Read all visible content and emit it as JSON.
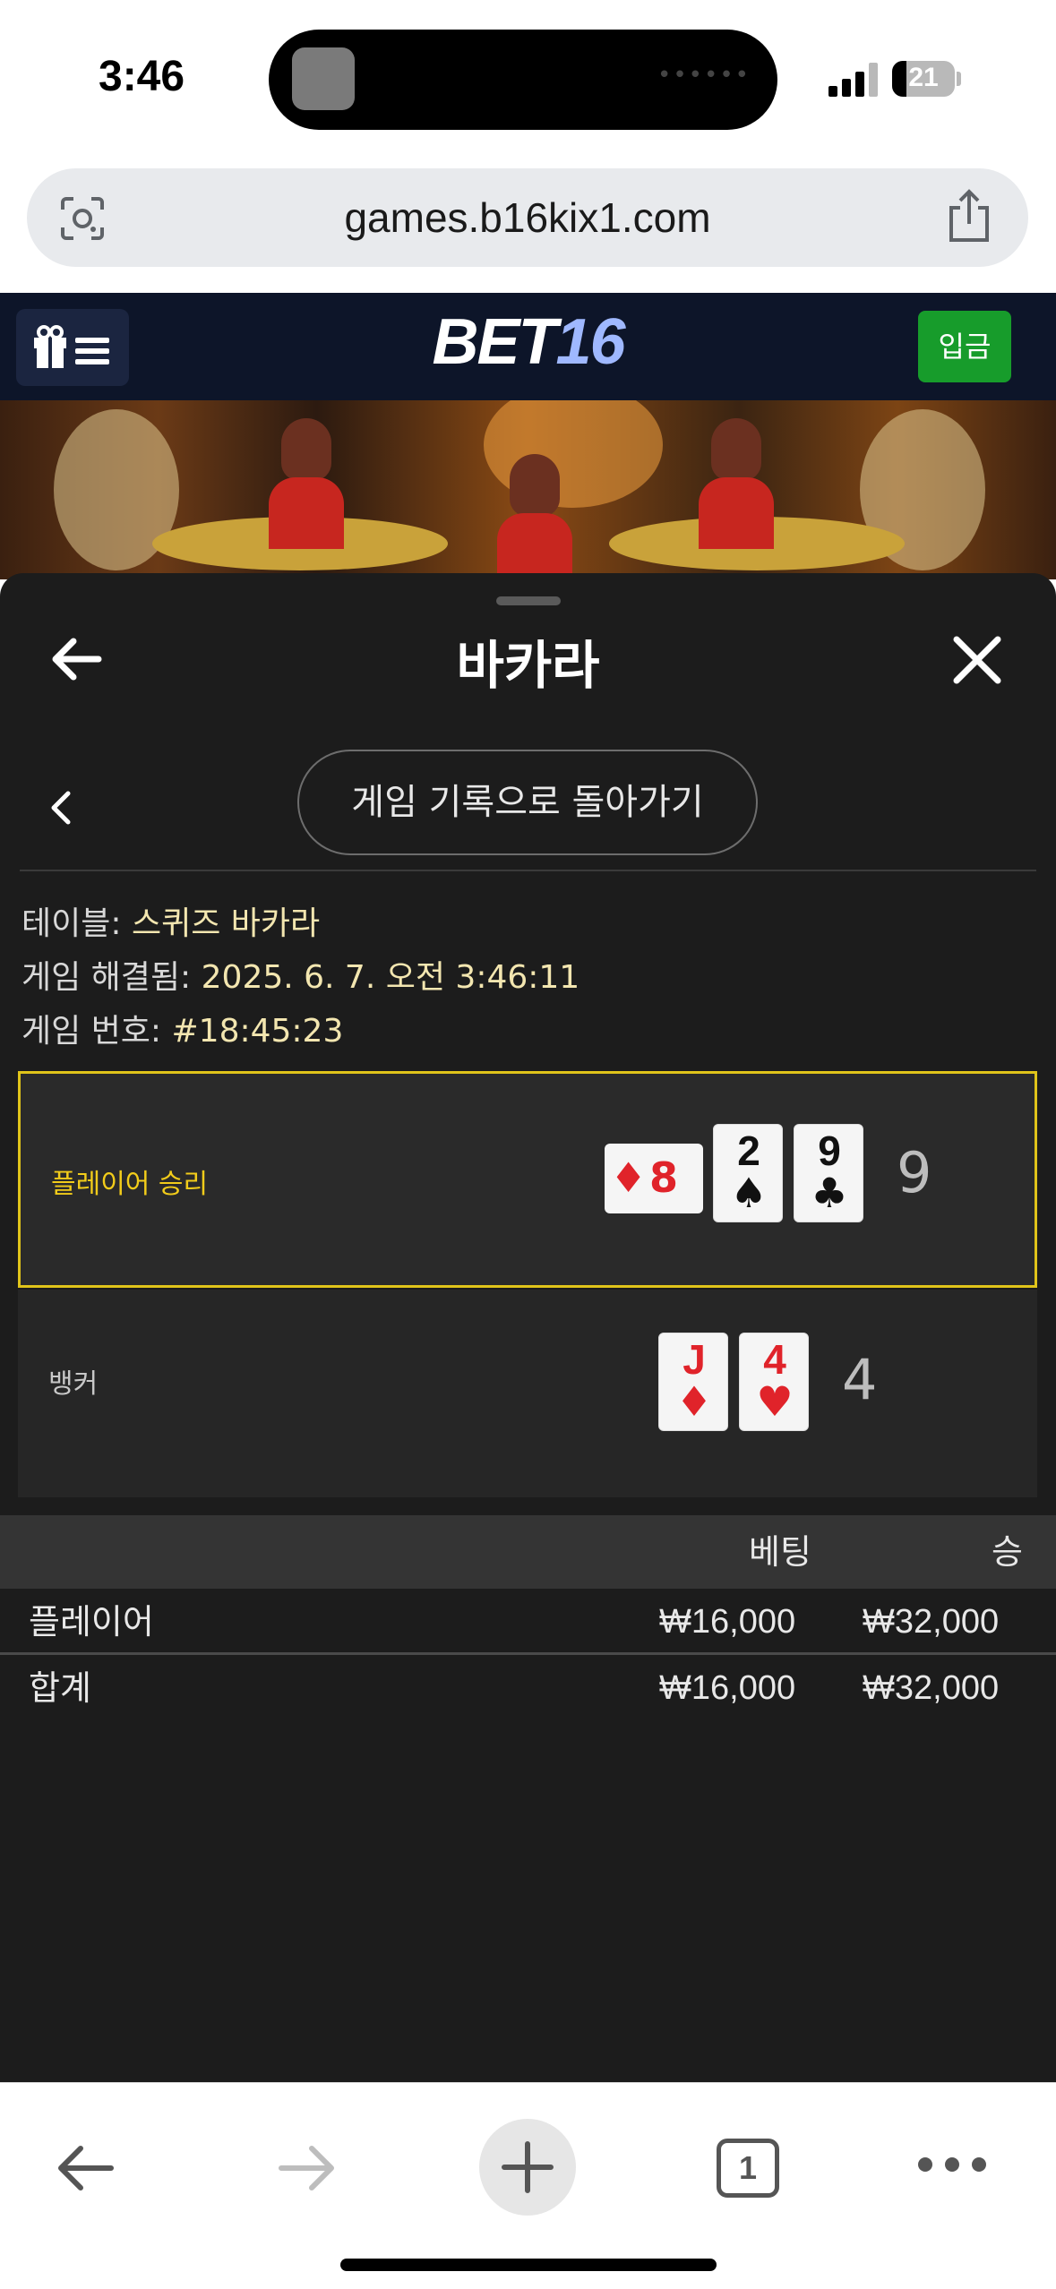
{
  "status_bar": {
    "time": "3:46",
    "battery": "21"
  },
  "browser": {
    "url": "games.b16kix1.com",
    "open_tabs": "1"
  },
  "site_header": {
    "logo_main": "BET",
    "logo_accent": "16",
    "deposit_label": "입금",
    "accent_color": "#9fb8ff",
    "deposit_color": "#179c2b"
  },
  "panel": {
    "title": "바카라",
    "history_button": "게임 기록으로 돌아가기",
    "info": {
      "table_label": "테이블:",
      "table_value": "스퀴즈 바카라",
      "resolved_label": "게임 해결됨:",
      "resolved_value": "2025. 6. 7. 오전 3:46:11",
      "round_label": "게임 번호:",
      "round_value": "#18:45:23"
    },
    "player": {
      "label": "플레이어 승리",
      "score": "9",
      "cards": [
        {
          "rank": "8",
          "suit": "♦",
          "color": "red",
          "orientation": "sideways"
        },
        {
          "rank": "2",
          "suit": "♠",
          "color": "black"
        },
        {
          "rank": "9",
          "suit": "♣",
          "color": "black"
        }
      ]
    },
    "banker": {
      "label": "뱅커",
      "score": "4",
      "cards": [
        {
          "rank": "J",
          "suit": "♦",
          "color": "red"
        },
        {
          "rank": "4",
          "suit": "♥",
          "color": "red"
        }
      ]
    },
    "bets": {
      "header_bet": "베팅",
      "header_win": "승",
      "rows": [
        {
          "label": "플레이어",
          "bet": "₩16,000",
          "win": "₩32,000"
        },
        {
          "label": "합계",
          "bet": "₩16,000",
          "win": "₩32,000"
        }
      ]
    },
    "highlight_color": "#e0c41a"
  }
}
